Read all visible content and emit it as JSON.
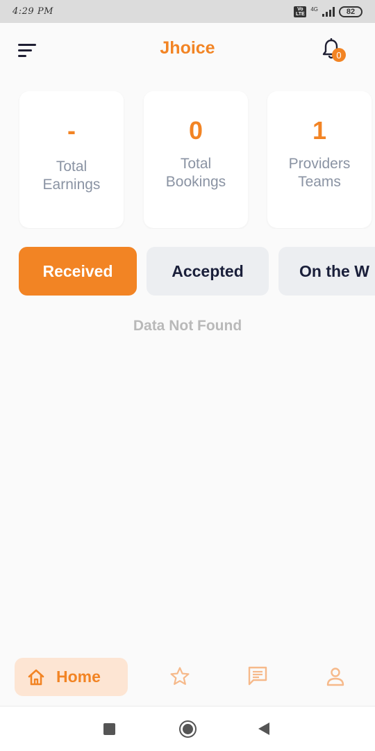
{
  "status_bar": {
    "time": "4:29 PM",
    "volte_top": "Vo",
    "volte_bottom": "LTE",
    "network": "4G",
    "battery": "82"
  },
  "header": {
    "title": "Jhoice",
    "notification_count": "0",
    "menu_icon": "hamburger-menu-icon",
    "bell_icon": "bell-icon"
  },
  "stats": [
    {
      "value": "-",
      "label_line1": "Total",
      "label_line2": "Earnings"
    },
    {
      "value": "0",
      "label_line1": "Total",
      "label_line2": "Bookings"
    },
    {
      "value": "1",
      "label_line1": "Providers",
      "label_line2": "Teams"
    }
  ],
  "tabs": [
    {
      "label": "Received",
      "active": true
    },
    {
      "label": "Accepted",
      "active": false
    },
    {
      "label": "On the W",
      "active": false
    }
  ],
  "empty_message": "Data Not Found",
  "bottom_nav": {
    "home_label": "Home",
    "items": [
      "home-icon",
      "star-icon",
      "chat-icon",
      "profile-icon"
    ]
  },
  "colors": {
    "accent": "#f28424",
    "accent_light": "#fde5d3",
    "label_gray": "#8a93a3",
    "dark_text": "#1a1f3a",
    "tab_inactive_bg": "#eceef1"
  }
}
